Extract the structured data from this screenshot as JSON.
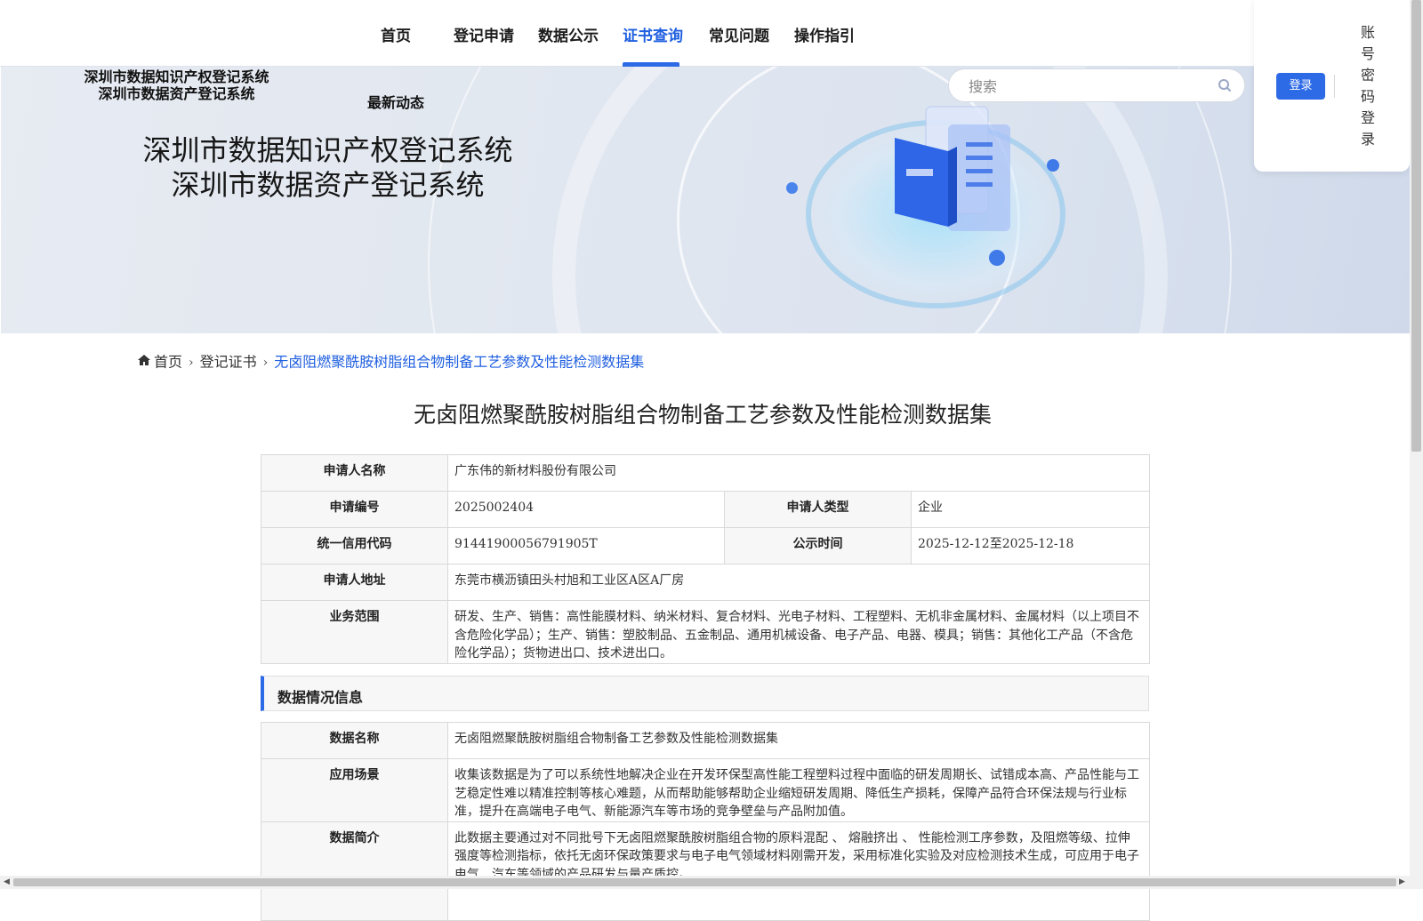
{
  "nav": {
    "items": [
      {
        "label": "首页"
      },
      {
        "label": "登记申请"
      },
      {
        "label": "数据公示"
      },
      {
        "label": "证书查询"
      },
      {
        "label": "常见问题"
      },
      {
        "label": "操作指引"
      }
    ],
    "active": "证书查询"
  },
  "banner": {
    "small_title_1": "深圳市数据知识产权登记系统",
    "small_title_2": "深圳市数据资产登记系统",
    "news_link": "最新动态",
    "big_title_1": "深圳市数据知识产权登记系统",
    "big_title_2": "深圳市数据资产登记系统",
    "search_placeholder": "搜索"
  },
  "login": {
    "button": "登录",
    "account_login": "账号密码登录"
  },
  "breadcrumb": {
    "home": "首页",
    "level2": "登记证书",
    "current": "无卤阻燃聚酰胺树脂组合物制备工艺参数及性能检测数据集"
  },
  "page_title": "无卤阻燃聚酰胺树脂组合物制备工艺参数及性能检测数据集",
  "applicant": {
    "name_label": "申请人名称",
    "name_value": "广东伟的新材料股份有限公司",
    "code_label": "申请编号",
    "code_value": "2025002404",
    "type_label": "申请人类型",
    "type_value": "企业",
    "credit_label": "统一信用代码",
    "credit_value": "91441900056791905T",
    "publicity_label": "公示时间",
    "publicity_value": "2025-12-12至2025-12-18",
    "address_label": "申请人地址",
    "address_value": "东莞市横沥镇田头村旭和工业区A区A厂房",
    "scope_label": "业务范围",
    "scope_value": "研发、生产、销售：高性能膜材料、纳米材料、复合材料、光电子材料、工程塑料、无机非金属材料、金属材料（以上项目不含危险化学品）；生产、销售：塑胶制品、五金制品、通用机械设备、电子产品、电器、模具；销售：其他化工产品（不含危险化学品）；货物进出口、技术进出口。"
  },
  "data_section": {
    "header": "数据情况信息",
    "data_name_label": "数据名称",
    "data_name_value": "无卤阻燃聚酰胺树脂组合物制备工艺参数及性能检测数据集",
    "scenario_label": "应用场景",
    "scenario_value": "收集该数据是为了可以系统性地解决企业在开发环保型高性能工程塑料过程中面临的研发周期长、试错成本高、产品性能与工艺稳定性难以精准控制等核心难题，从而帮助能够帮助企业缩短研发周期、降低生产损耗，保障产品符合环保法规与行业标准，提升在高端电子电气、新能源汽车等市场的竞争壁垒与产品附加值。",
    "intro_label": "数据简介",
    "intro_value": "此数据主要通过对不同批号下无卤阻燃聚酰胺树脂组合物的原料混配 、 熔融挤出 、 性能检测工序参数，及阻燃等级、拉伸强度等检测指标，依托无卤环保政策要求与电子电气领域材料刚需开发，采用标准化实验及对应检测技术生成，可应用于电子电气、汽车等领域的产品研发与量产质控。"
  }
}
